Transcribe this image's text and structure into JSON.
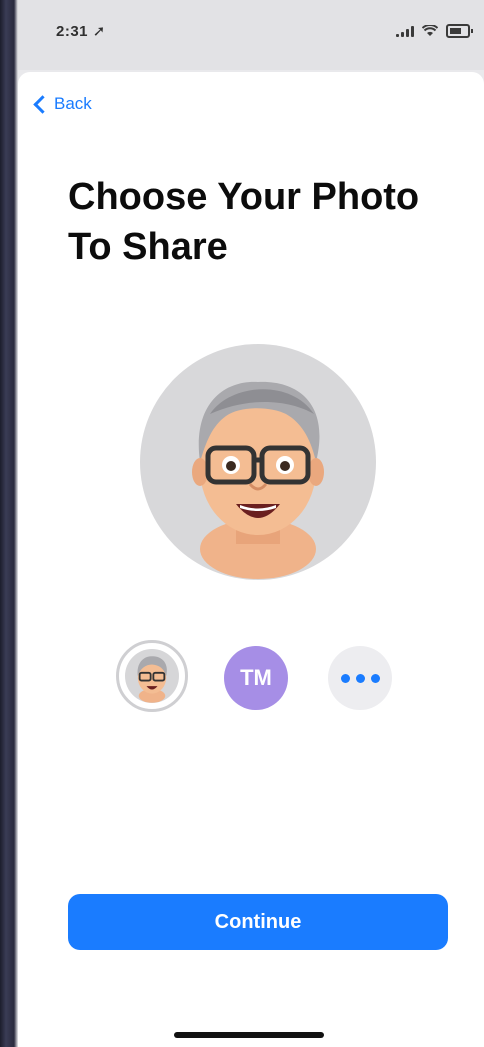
{
  "status_bar": {
    "time": "2:31 ➚"
  },
  "nav": {
    "back_label": "Back"
  },
  "page": {
    "title": "Choose Your Photo To Share"
  },
  "photo_options": {
    "initials": "TM",
    "selected": "memoji"
  },
  "actions": {
    "continue_label": "Continue"
  },
  "colors": {
    "accent": "#1a7cff",
    "initials_bg": "#a68ee6"
  }
}
